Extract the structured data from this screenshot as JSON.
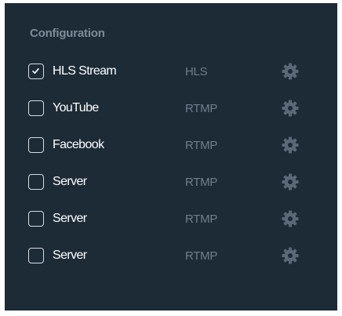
{
  "section": {
    "title": "Configuration"
  },
  "colors": {
    "panel_bg": "#1d2b37",
    "title": "#7d8c99",
    "name": "#ffffff",
    "protocol": "#6f7f8c",
    "gear": "#5a6975",
    "checkbox_border": "#d5dde4"
  },
  "destinations": [
    {
      "name": "HLS Stream",
      "protocol": "HLS",
      "checked": true,
      "icon": "gear-icon"
    },
    {
      "name": "YouTube",
      "protocol": "RTMP",
      "checked": false,
      "icon": "gear-icon"
    },
    {
      "name": "Facebook",
      "protocol": "RTMP",
      "checked": false,
      "icon": "gear-icon"
    },
    {
      "name": "Server",
      "protocol": "RTMP",
      "checked": false,
      "icon": "gear-icon"
    },
    {
      "name": "Server",
      "protocol": "RTMP",
      "checked": false,
      "icon": "gear-icon"
    },
    {
      "name": "Server",
      "protocol": "RTMP",
      "checked": false,
      "icon": "gear-icon"
    }
  ]
}
